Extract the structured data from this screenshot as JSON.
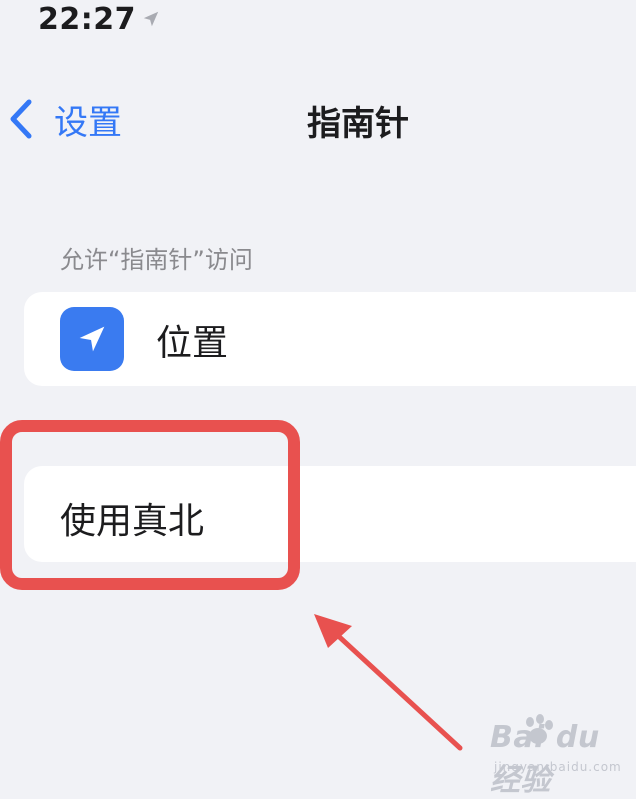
{
  "status_bar": {
    "time": "22:27",
    "location_icon": "location-arrow-icon"
  },
  "nav": {
    "back_label": "设置",
    "back_icon": "chevron-left-icon",
    "title": "指南针"
  },
  "permissions": {
    "section_header": "允许“指南针”访问",
    "items": [
      {
        "label": "位置",
        "icon": "location-arrow-icon",
        "icon_color": "#3a7bf0"
      }
    ]
  },
  "settings": {
    "items": [
      {
        "label": "使用真北"
      }
    ]
  },
  "annotation": {
    "highlight_color": "#e8514f",
    "arrow_color": "#e8514f"
  },
  "watermark": {
    "main": "Bai du 经验",
    "sub": "jingyan.baidu.com"
  },
  "colors": {
    "accent": "#3478f6",
    "background": "#f1f2f6",
    "card": "#ffffff"
  }
}
